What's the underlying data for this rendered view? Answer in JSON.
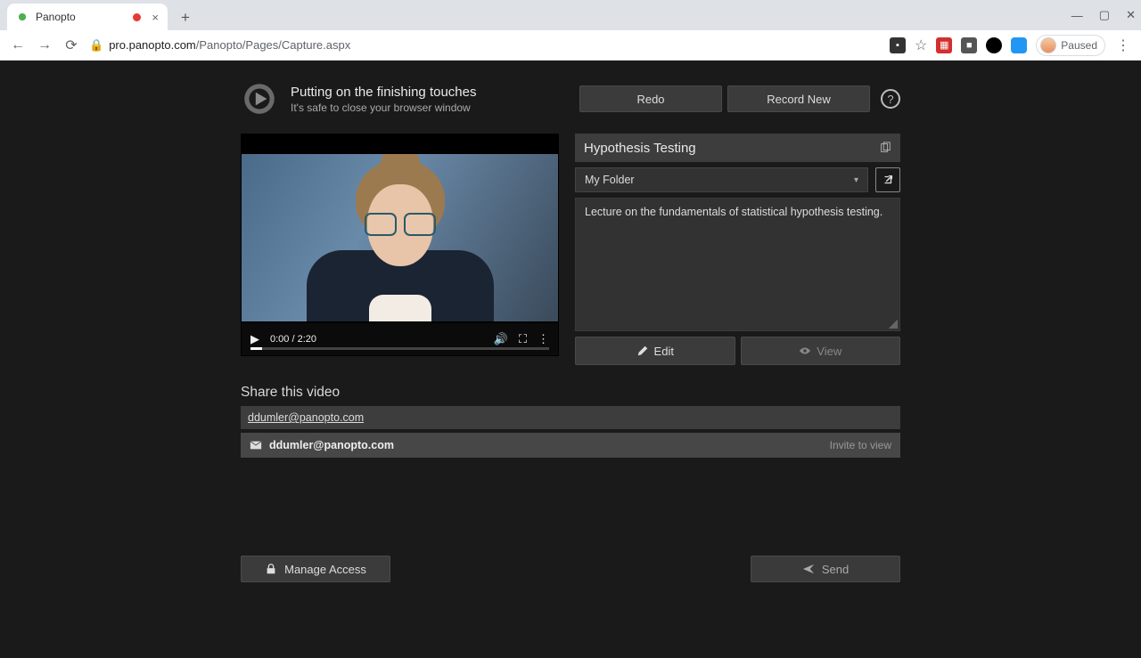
{
  "browser": {
    "tab_title": "Panopto",
    "url_host": "pro.panopto.com",
    "url_path": "/Panopto/Pages/Capture.aspx",
    "paused_label": "Paused"
  },
  "header": {
    "title": "Putting on the finishing touches",
    "subtitle": "It's safe to close your browser window",
    "redo_label": "Redo",
    "record_new_label": "Record New"
  },
  "video": {
    "time_current": "0:00",
    "time_total": "2:20",
    "time_display": "0:00 / 2:20"
  },
  "details": {
    "title": "Hypothesis Testing",
    "folder": "My Folder",
    "description": "Lecture on the fundamentals of statistical hypothesis testing.",
    "edit_label": "Edit",
    "view_label": "View"
  },
  "share": {
    "heading": "Share this video",
    "input_value": "ddumler@panopto.com",
    "chip_email": "ddumler@panopto.com",
    "chip_hint": "Invite to view",
    "manage_label": "Manage Access",
    "send_label": "Send"
  }
}
